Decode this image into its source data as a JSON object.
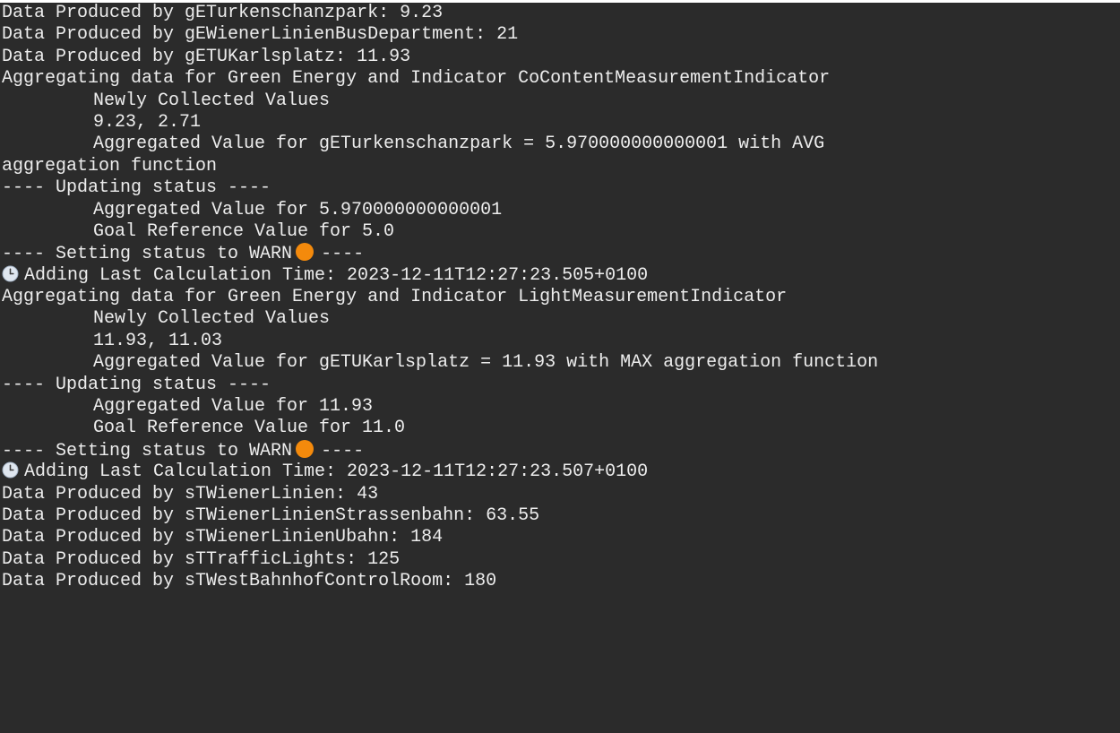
{
  "terminal": {
    "lines": [
      "Data Produced by gETurkenschanzpark: 9.23",
      "Data Produced by gEWienerLinienBusDepartment: 21",
      "Data Produced by gETUKarlsplatz: 11.93",
      "Aggregating data for Green Energy and Indicator CoContentMeasurementIndicator",
      "Newly Collected Values",
      "9.23, 2.71",
      "Aggregated Value for gETurkenschanzpark = 5.970000000000001 with AVG",
      "aggregation function",
      "---- Updating status ----",
      "Aggregated Value for 5.970000000000001",
      "Goal Reference Value for 5.0",
      "---- Setting status to WARN",
      "----",
      "Adding Last Calculation Time: 2023-12-11T12:27:23.505+0100",
      "Aggregating data for Green Energy and Indicator LightMeasurementIndicator",
      "Newly Collected Values",
      "11.93, 11.03",
      "Aggregated Value for gETUKarlsplatz = 11.93 with MAX aggregation function",
      "---- Updating status ----",
      "Aggregated Value for 11.93",
      "Goal Reference Value for 11.0",
      "---- Setting status to WARN",
      "----",
      "Adding Last Calculation Time: 2023-12-11T12:27:23.507+0100",
      "Data Produced by sTWienerLinien: 43",
      "Data Produced by sTWienerLinienStrassenbahn: 63.55",
      "Data Produced by sTWienerLinienUbahn: 184",
      "Data Produced by sTTrafficLights: 125",
      "Data Produced by sTWestBahnhofControlRoom: 180"
    ]
  },
  "icons": {
    "warn_dot": "orange-circle",
    "clock": "clock-icon"
  },
  "colors": {
    "background": "#2b2b2b",
    "text": "#ededed",
    "warn": "#f48a0c"
  }
}
